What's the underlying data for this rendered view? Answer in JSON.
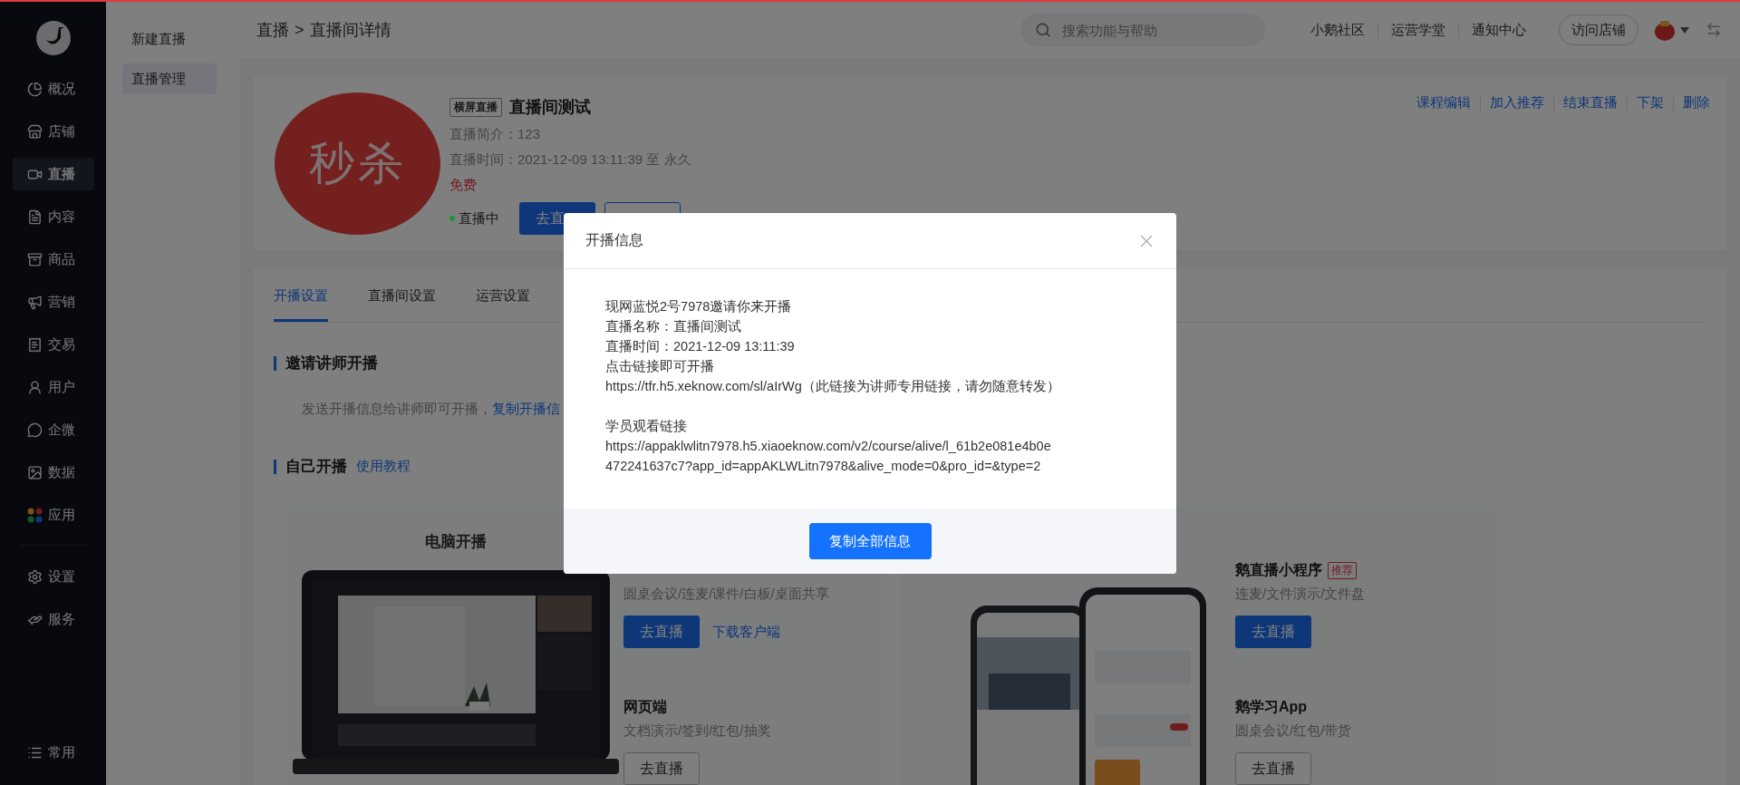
{
  "sidebar": {
    "items": [
      {
        "label": "概况",
        "selected": false
      },
      {
        "label": "店铺",
        "selected": false
      },
      {
        "label": "直播",
        "selected": true
      },
      {
        "label": "内容",
        "selected": false
      },
      {
        "label": "商品",
        "selected": false
      },
      {
        "label": "营销",
        "selected": false
      },
      {
        "label": "交易",
        "selected": false
      },
      {
        "label": "用户",
        "selected": false
      },
      {
        "label": "企微",
        "selected": false
      },
      {
        "label": "数据",
        "selected": false
      },
      {
        "label": "应用",
        "selected": false
      }
    ],
    "bottom_items": [
      {
        "label": "设置",
        "selected": false
      },
      {
        "label": "服务",
        "selected": false
      }
    ],
    "pinned": {
      "label": "常用"
    }
  },
  "submenu": [
    {
      "label": "新建直播",
      "selected": false
    },
    {
      "label": "直播管理",
      "selected": true
    }
  ],
  "breadcrumb": {
    "items": [
      "直播",
      "直播间详情"
    ],
    "separator": ">"
  },
  "topbar": {
    "search": {
      "placeholder": "搜索功能与帮助"
    },
    "links": [
      "小鹅社区",
      "运营学堂",
      "通知中心"
    ],
    "visit_button": "访问店铺"
  },
  "course": {
    "cover_text": "秒杀",
    "badge": "横屏直播",
    "title": "直播间测试",
    "details": [
      "直播简介：123",
      "直播时间：2021-12-09 13:11:39 至 永久"
    ],
    "price": "免费",
    "status": {
      "label": "直播中",
      "color": "#23923d"
    },
    "primary_button": "去直",
    "actions": [
      "课程编辑",
      "加入推荐",
      "结束直播",
      "下架",
      "删除"
    ]
  },
  "tabs": [
    {
      "label": "开播设置",
      "selected": true
    },
    {
      "label": "直播间设置",
      "selected": false
    },
    {
      "label": "运营设置",
      "selected": false
    }
  ],
  "invite": {
    "title": "邀请讲师开播",
    "text": "发送开播信息给讲师即可开播，",
    "link": "复制开播信"
  },
  "self_start": {
    "title": "自己开播",
    "link": "使用教程"
  },
  "cards": [
    {
      "kind": "laptop",
      "title": "电脑开播",
      "options": [
        {
          "desc": "圆桌会议/连麦/课件/白板/桌面共享",
          "button": "去直播",
          "kind": "primary",
          "link": "下载客户端"
        },
        {
          "name": "网页端",
          "desc": "文档演示/签到/红包/抽奖",
          "button": "去直播",
          "kind": "outline"
        }
      ]
    },
    {
      "kind": "phones",
      "options": [
        {
          "name": "鹅直播小程序",
          "tag": "推荐",
          "desc": "连麦/文件演示/文件盘",
          "button": "去直播",
          "kind": "primary"
        },
        {
          "name": "鹅学习App",
          "desc": "圆桌会议/红包/带货",
          "button": "去直播",
          "kind": "outline"
        }
      ]
    }
  ],
  "modal": {
    "title": "开播信息",
    "sections": [
      [
        "现网蓝悦2号7978邀请你来开播",
        "直播名称：直播间测试",
        "直播时间：2021-12-09 13:11:39",
        "点击链接即可开播",
        "https://tfr.h5.xeknow.com/sl/aIrWg（此链接为讲师专用链接，请勿随意转发）"
      ],
      [
        "学员观看链接",
        "https://appaklwlitn7978.h5.xiaoeknow.com/v2/course/alive/l_61b2e081e4b0e",
        "472241637c7?app_id=appAKLWLitn7978&alive_mode=0&pro_id=&type=2"
      ]
    ],
    "button": "复制全部信息"
  }
}
